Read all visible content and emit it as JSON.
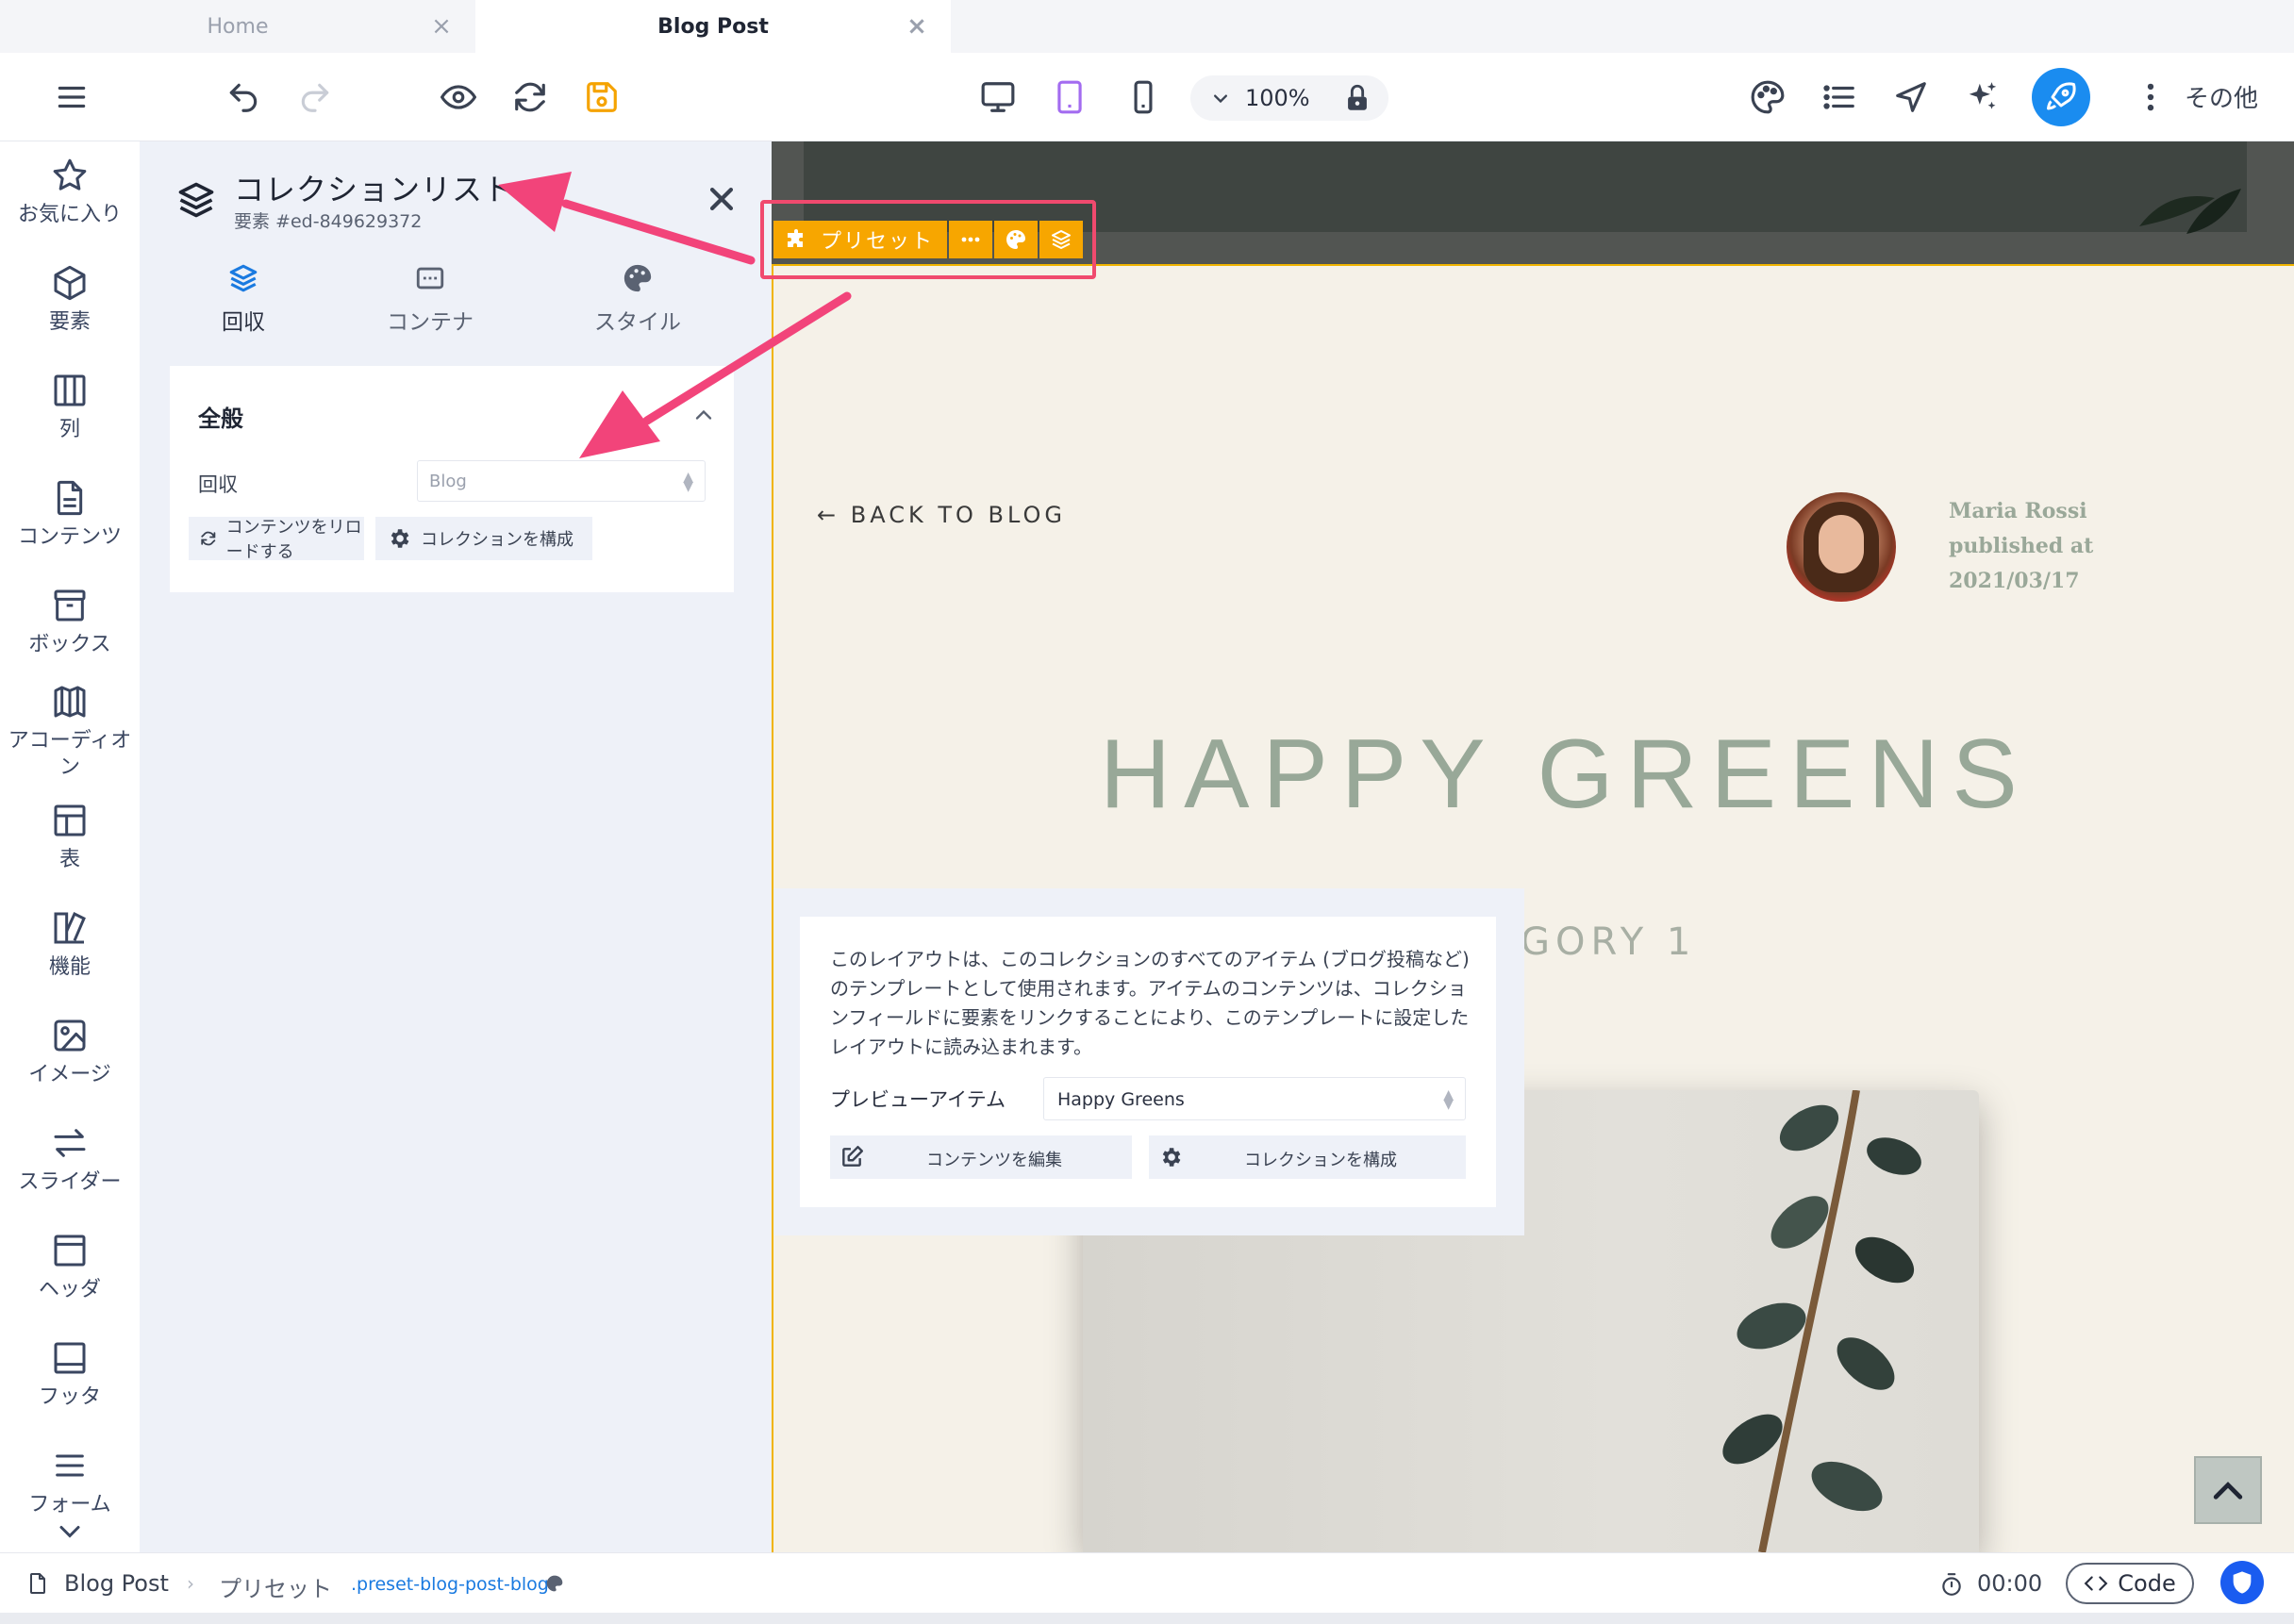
{
  "tabs": [
    {
      "label": "Home",
      "active": false
    },
    {
      "label": "Blog Post",
      "active": true
    }
  ],
  "toolbar": {
    "zoom": "100%",
    "more_label": "その他",
    "icons": [
      "menu-icon",
      "undo-icon",
      "redo-icon",
      "preview-eye-icon",
      "refresh-icon",
      "save-icon",
      "desktop-icon",
      "tablet-icon",
      "mobile-icon",
      "chevron-down-icon",
      "lock-icon",
      "palette-icon",
      "list-icon",
      "navigate-icon",
      "ai-sparkle-icon",
      "rocket-icon",
      "kebab-icon"
    ],
    "accent_color": "#1a8cf0",
    "save_color": "#f5a300"
  },
  "rail": {
    "items": [
      {
        "label": "お気に入り",
        "icon": "star-icon"
      },
      {
        "label": "要素",
        "icon": "cube-icon"
      },
      {
        "label": "列",
        "icon": "columns-icon"
      },
      {
        "label": "コンテンツ",
        "icon": "document-icon"
      },
      {
        "label": "ボックス",
        "icon": "archive-box-icon"
      },
      {
        "label": "アコーディオン",
        "icon": "accordion-icon"
      },
      {
        "label": "表",
        "icon": "table-icon"
      },
      {
        "label": "機能",
        "icon": "features-icon"
      },
      {
        "label": "イメージ",
        "icon": "image-icon"
      },
      {
        "label": "スライダー",
        "icon": "slider-arrows-icon"
      },
      {
        "label": "ヘッダ",
        "icon": "header-icon"
      },
      {
        "label": "フッタ",
        "icon": "footer-icon"
      },
      {
        "label": "フォーム",
        "icon": "form-icon"
      }
    ]
  },
  "panel": {
    "title": "コレクションリスト",
    "subtitle": "要素 #ed-849629372",
    "tabs": [
      {
        "label": "回収",
        "icon": "layers-icon",
        "active": true
      },
      {
        "label": "コンテナ",
        "icon": "container-icon",
        "active": false
      },
      {
        "label": "スタイル",
        "icon": "palette-icon",
        "active": false
      }
    ],
    "general": {
      "heading": "全般",
      "field_label": "回収",
      "field_value": "Blog",
      "reload_button": "コンテンツをリロードする",
      "configure_button": "コレクションを構成"
    }
  },
  "preset_bar": {
    "label": "プリセット",
    "color": "#f7a600",
    "highlight_color": "#f04a6e"
  },
  "page": {
    "back_link": "← BACK TO BLOG",
    "author_line1": "Maria Rossi",
    "author_line2": "published at",
    "author_line3": "2021/03/17",
    "title": "HAPPY GREENS",
    "category": "GORY 1"
  },
  "info_popover": {
    "text": "このレイアウトは、このコレクションのすべてのアイテム (ブログ投稿など) のテンプレートとして使用されます。アイテムのコンテンツは、コレクションフィールドに要素をリンクすることにより、このテンプレートに設定したレイアウトに読み込まれます。",
    "preview_label": "プレビューアイテム",
    "preview_value": "Happy Greens",
    "edit_button": "コンテンツを編集",
    "configure_button": "コレクションを構成"
  },
  "statusbar": {
    "page_name": "Blog Post",
    "preset": "プリセット",
    "class_name": ".preset-blog-post-blog",
    "timer": "00:00",
    "code_label": "Code"
  }
}
